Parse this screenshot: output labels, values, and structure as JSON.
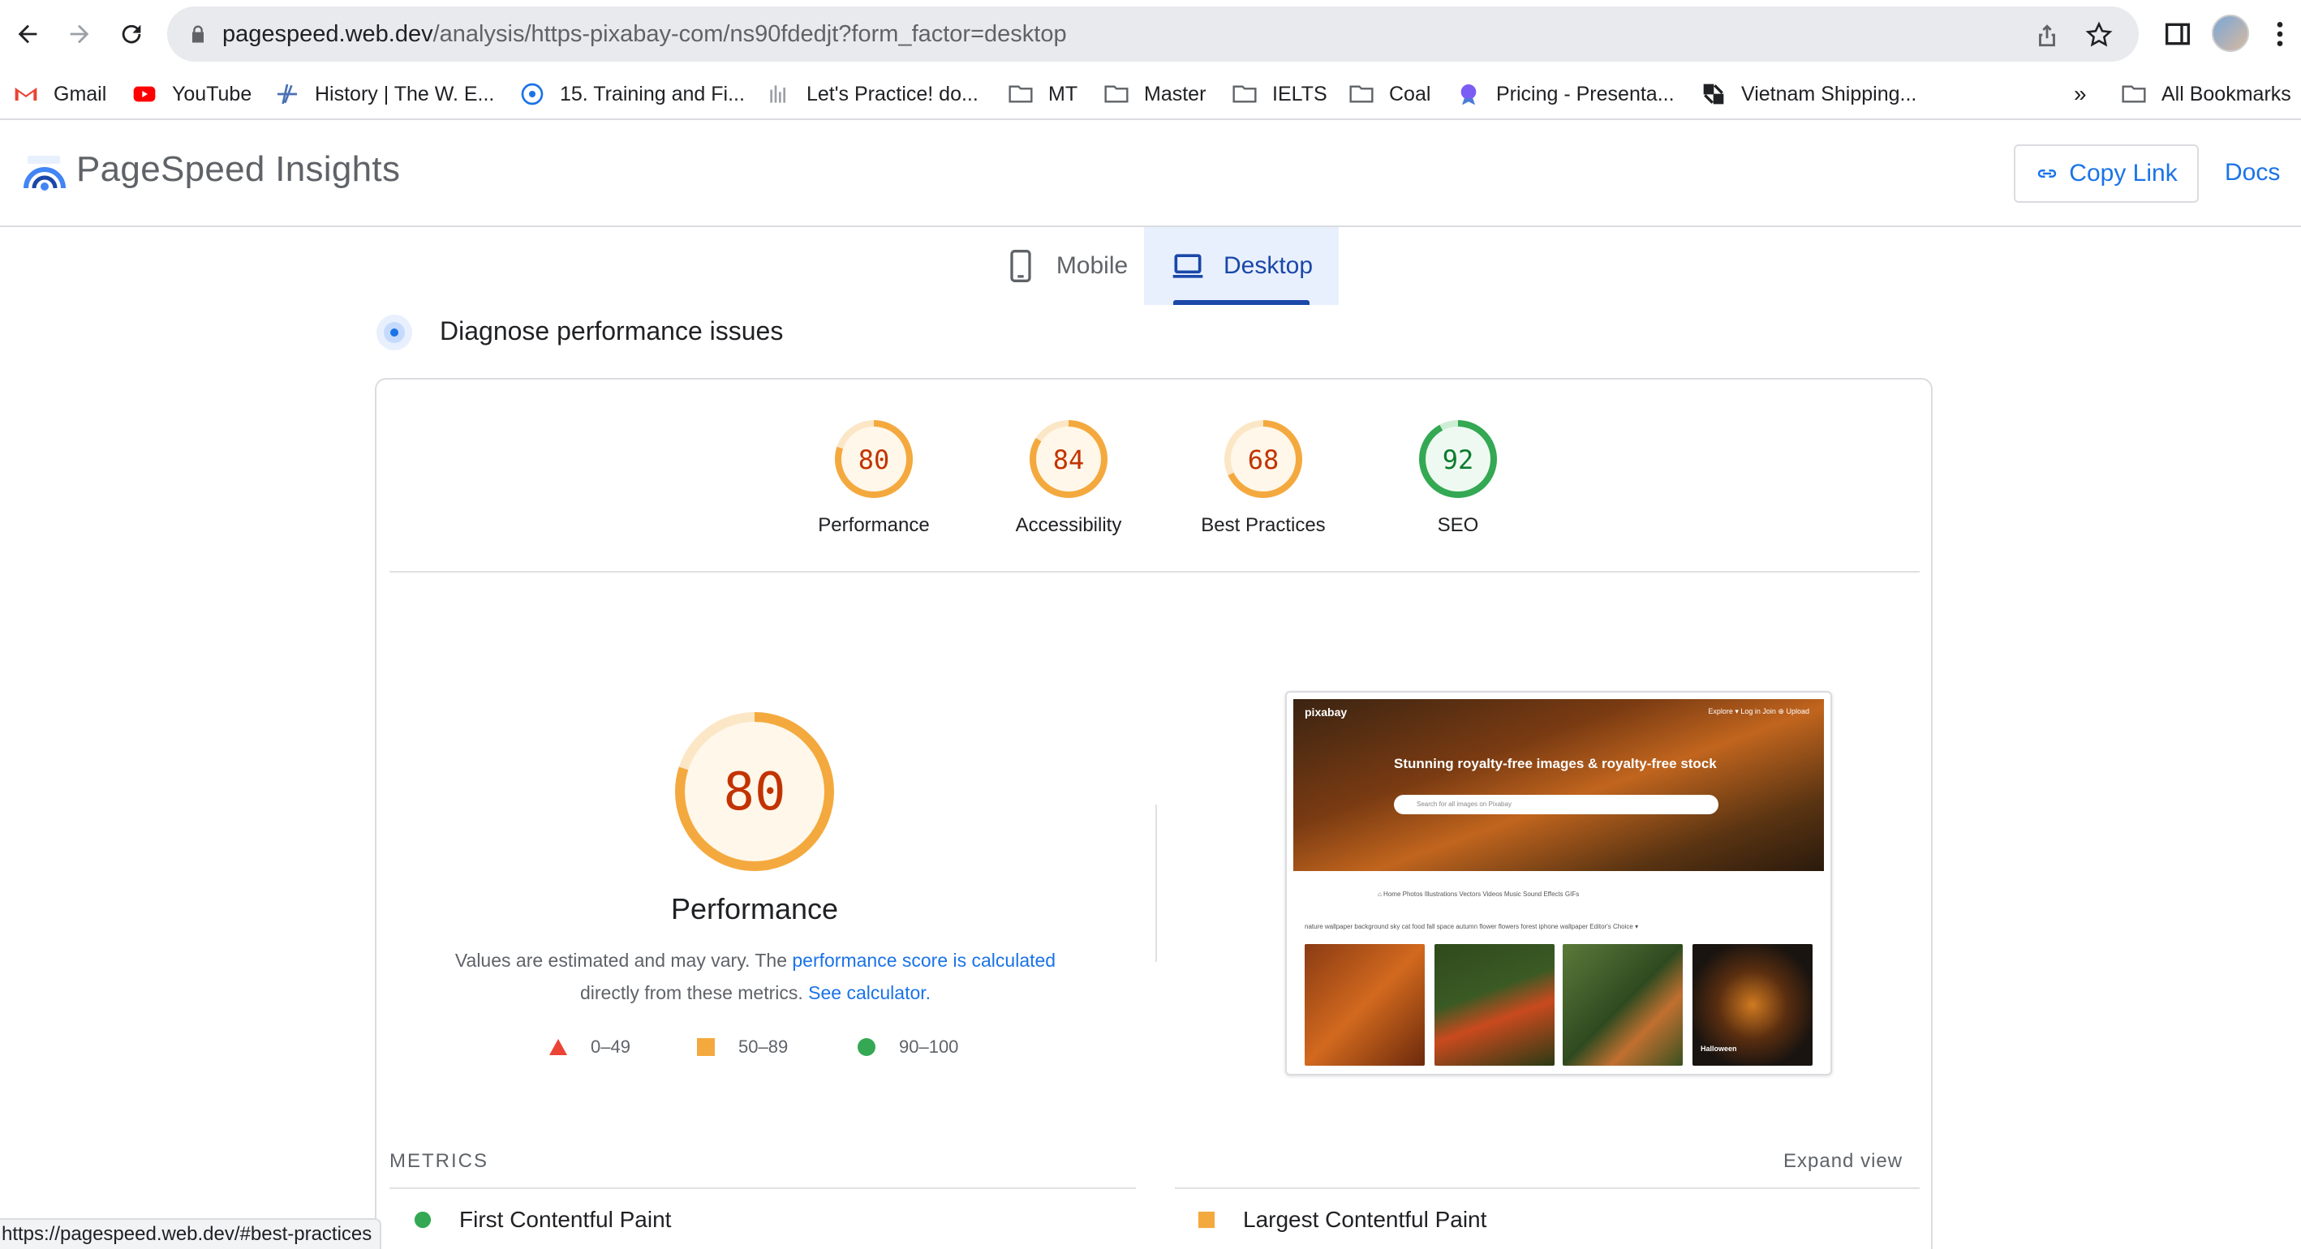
{
  "browser": {
    "url_host": "pagespeed.web.dev",
    "url_path": "/analysis/https-pixabay-com/ns90fdedjt?form_factor=desktop",
    "status_url": "https://pagespeed.web.dev/#best-practices",
    "bookmarks": [
      {
        "label": "Gmail",
        "icon": "gmail-icon"
      },
      {
        "label": "YouTube",
        "icon": "youtube-icon"
      },
      {
        "label": "History | The W. E...",
        "icon": "history-site-icon"
      },
      {
        "label": "15. Training and Fi...",
        "icon": "globe-icon"
      },
      {
        "label": "Let's Practice! do...",
        "icon": "chart-site-icon"
      },
      {
        "label": "MT",
        "icon": "folder-icon"
      },
      {
        "label": "Master",
        "icon": "folder-icon"
      },
      {
        "label": "IELTS",
        "icon": "folder-icon"
      },
      {
        "label": "Coal",
        "icon": "folder-icon"
      },
      {
        "label": "Pricing - Presenta...",
        "icon": "presentation-site-icon"
      },
      {
        "label": "Vietnam Shipping...",
        "icon": "shipping-site-icon"
      }
    ],
    "overflow_label": "»",
    "all_bookmarks_label": "All Bookmarks"
  },
  "header": {
    "title": "PageSpeed Insights",
    "copy_link_label": "Copy Link",
    "docs_label": "Docs"
  },
  "tabs": {
    "mobile": "Mobile",
    "desktop": "Desktop",
    "active": "desktop"
  },
  "diagnose": {
    "title": "Diagnose performance issues"
  },
  "scores": [
    {
      "name": "Performance",
      "value": 80,
      "status": "average"
    },
    {
      "name": "Accessibility",
      "value": 84,
      "status": "average"
    },
    {
      "name": "Best Practices",
      "value": 68,
      "status": "average"
    },
    {
      "name": "SEO",
      "value": 92,
      "status": "pass"
    }
  ],
  "performance": {
    "score": 80,
    "label": "Performance",
    "note_prefix": "Values are estimated and may vary. The ",
    "note_link1": "performance score is calculated",
    "note_middle": " directly from these metrics. ",
    "note_link2": "See calculator."
  },
  "legend": [
    {
      "range": "0–49",
      "shape": "triangle",
      "color": "#eb4335"
    },
    {
      "range": "50–89",
      "shape": "square",
      "color": "#f4a93e"
    },
    {
      "range": "90–100",
      "shape": "circle",
      "color": "#34a853"
    }
  ],
  "screenshot": {
    "logo": "pixabay",
    "nav": "Explore ▾     Log in     Join     ⊕ Upload",
    "headline": "Stunning royalty-free images & royalty-free stock",
    "search_placeholder": "Search for all images on Pixabay",
    "chips": "⌂ Home    Photos    Illustrations    Vectors    Videos    Music    Sound Effects    GIFs",
    "tags": "nature   wallpaper   background   sky   cat   food   fall   space   autumn   flower   flowers   forest   iphone wallpaper        Editor's Choice ▾",
    "halloween_label": "Halloween"
  },
  "metrics": {
    "section_label": "METRICS",
    "expand_label": "Expand view",
    "items": [
      {
        "name": "First Contentful Paint",
        "status": "pass"
      },
      {
        "name": "Largest Contentful Paint",
        "status": "average"
      }
    ]
  },
  "colors": {
    "average": "#f4a93e",
    "average_text": "#c33300",
    "pass": "#34a853",
    "pass_text": "#0c7b2d",
    "fail": "#eb4335",
    "accent": "#1a73e8",
    "tab_active": "#1a47a8"
  }
}
